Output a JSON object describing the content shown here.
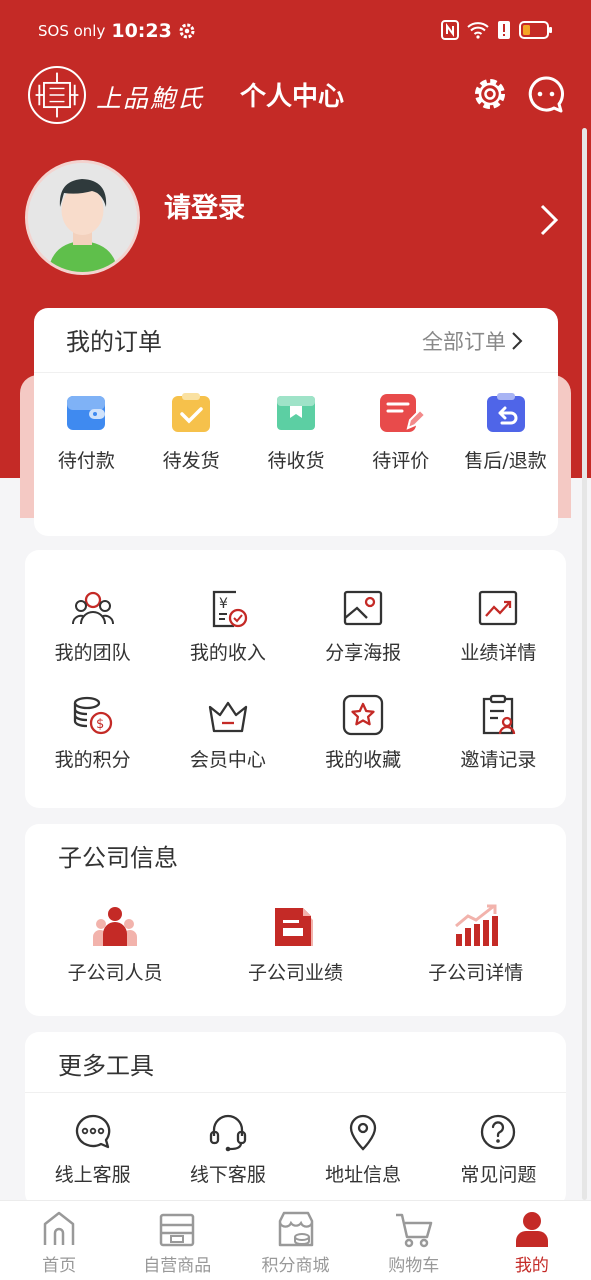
{
  "status_bar": {
    "carrier": "SOS only",
    "time": "10:23"
  },
  "header": {
    "brand": "上品鮑氏",
    "title": "个人中心"
  },
  "profile": {
    "login_text": "请登录"
  },
  "orders": {
    "title": "我的订单",
    "all_label": "全部订单",
    "items": [
      {
        "label": "待付款",
        "icon": "wallet-icon"
      },
      {
        "label": "待发货",
        "icon": "clipboard-check-icon"
      },
      {
        "label": "待收货",
        "icon": "package-icon"
      },
      {
        "label": "待评价",
        "icon": "review-pen-icon"
      },
      {
        "label": "售后/退款",
        "icon": "refund-icon"
      }
    ]
  },
  "services": {
    "items": [
      {
        "label": "我的团队",
        "icon": "team-icon"
      },
      {
        "label": "我的收入",
        "icon": "income-icon"
      },
      {
        "label": "分享海报",
        "icon": "poster-icon"
      },
      {
        "label": "业绩详情",
        "icon": "performance-icon"
      },
      {
        "label": "我的积分",
        "icon": "points-icon"
      },
      {
        "label": "会员中心",
        "icon": "crown-icon"
      },
      {
        "label": "我的收藏",
        "icon": "star-icon"
      },
      {
        "label": "邀请记录",
        "icon": "invite-record-icon"
      }
    ]
  },
  "subsidiary": {
    "title": "子公司信息",
    "items": [
      {
        "label": "子公司人员",
        "icon": "people-icon"
      },
      {
        "label": "子公司业绩",
        "icon": "document-icon"
      },
      {
        "label": "子公司详情",
        "icon": "bar-chart-icon"
      }
    ]
  },
  "tools": {
    "title": "更多工具",
    "items": [
      {
        "label": "线上客服",
        "icon": "chat-icon"
      },
      {
        "label": "线下客服",
        "icon": "headset-icon"
      },
      {
        "label": "地址信息",
        "icon": "location-icon"
      },
      {
        "label": "常见问题",
        "icon": "question-icon"
      }
    ]
  },
  "tabbar": {
    "items": [
      {
        "label": "首页",
        "icon": "home-icon"
      },
      {
        "label": "自营商品",
        "icon": "store-icon"
      },
      {
        "label": "积分商城",
        "icon": "points-store-icon"
      },
      {
        "label": "购物车",
        "icon": "cart-icon"
      },
      {
        "label": "我的",
        "icon": "user-icon"
      }
    ],
    "active": "我的"
  },
  "colors": {
    "primary": "#c42a26",
    "pink": "#f4c9c4",
    "background": "#f5f5f7"
  }
}
